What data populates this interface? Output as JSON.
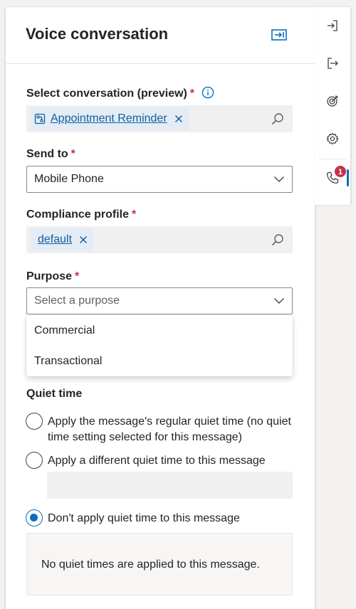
{
  "panel": {
    "title": "Voice conversation"
  },
  "conversation": {
    "label": "Select conversation (preview)",
    "required_mark": "*",
    "selected": "Appointment Reminder"
  },
  "send_to": {
    "label": "Send to",
    "required_mark": "*",
    "value": "Mobile Phone"
  },
  "compliance": {
    "label": "Compliance profile",
    "required_mark": "*",
    "selected": "default"
  },
  "purpose": {
    "label": "Purpose",
    "required_mark": "*",
    "placeholder": "Select a purpose",
    "options": [
      "Commercial",
      "Transactional"
    ]
  },
  "quiet_time": {
    "label": "Quiet time",
    "options": [
      "Apply the message's regular quiet time (no quiet time setting selected for this message)",
      "Apply a different quiet time to this message",
      "Don't apply quiet time to this message"
    ],
    "selected_index": 2,
    "note": "No quiet times are applied to this message."
  },
  "rail": {
    "icons": [
      "sign-in-icon",
      "sign-out-icon",
      "target-icon",
      "gear-icon",
      "phone-icon"
    ],
    "badge_count": "1",
    "active": "phone-icon"
  },
  "colors": {
    "accent": "#0f6cbd",
    "link": "#0f5f9e",
    "required": "#c4314b",
    "chip_bg": "#e4ecf5"
  }
}
